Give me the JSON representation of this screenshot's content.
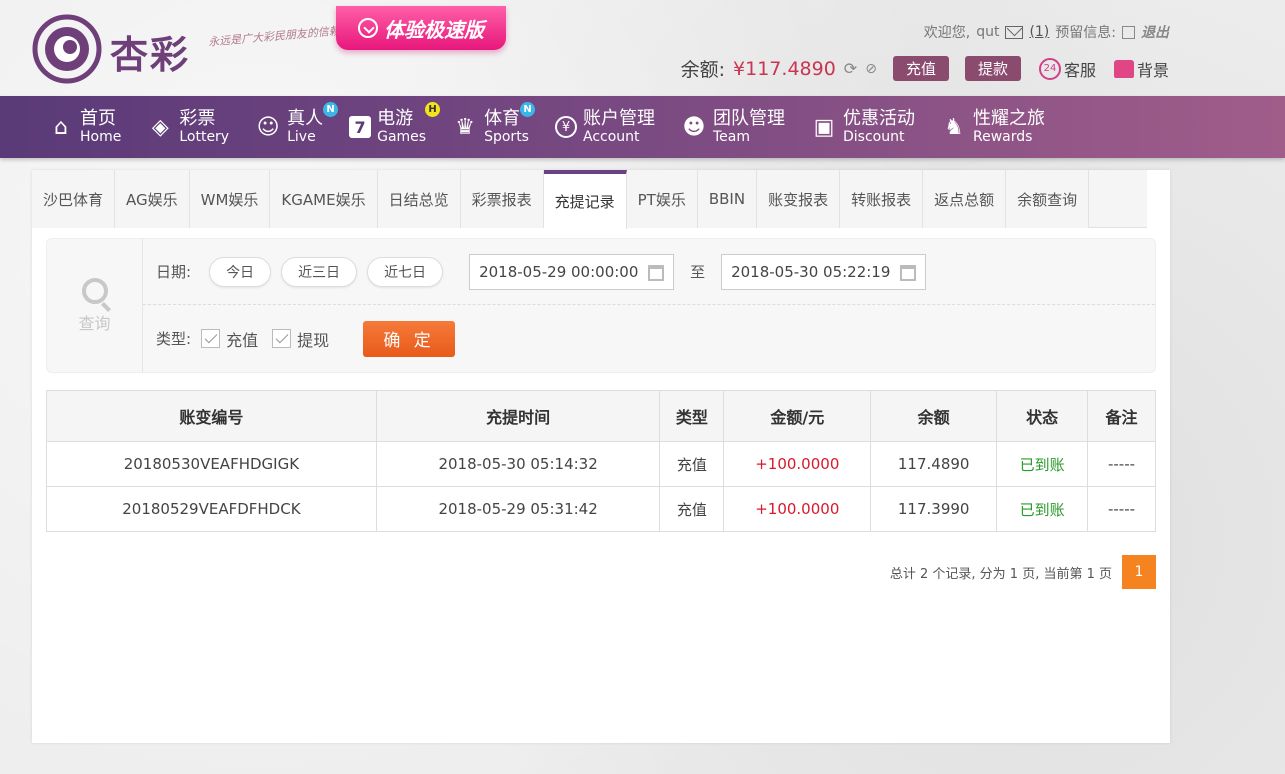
{
  "header": {
    "brand": "杏彩",
    "slogan": "永远是广大彩民朋友的信赖",
    "promo": "体验极速版",
    "welcome": "欢迎您,",
    "username": "qut",
    "messages": "(1)",
    "reserved_info": "预留信息:",
    "logout": "退出",
    "balance_label": "余额:",
    "balance_value": "¥117.4890",
    "deposit": "充值",
    "withdraw": "提款",
    "service": "客服",
    "background": "背景"
  },
  "nav": [
    {
      "cn": "首页",
      "en": "Home",
      "icon": "home-icon",
      "badge": ""
    },
    {
      "cn": "彩票",
      "en": "Lottery",
      "icon": "ticket-icon",
      "badge": ""
    },
    {
      "cn": "真人",
      "en": "Live",
      "icon": "dealer-icon",
      "badge": "N"
    },
    {
      "cn": "电游",
      "en": "Games",
      "icon": "seven-icon",
      "badge": "H"
    },
    {
      "cn": "体育",
      "en": "Sports",
      "icon": "trophy-icon",
      "badge": "N"
    },
    {
      "cn": "账户管理",
      "en": "Account",
      "icon": "yen-icon",
      "badge": ""
    },
    {
      "cn": "团队管理",
      "en": "Team",
      "icon": "team-icon",
      "badge": ""
    },
    {
      "cn": "优惠活动",
      "en": "Discount",
      "icon": "gift-icon",
      "badge": ""
    },
    {
      "cn": "性耀之旅",
      "en": "Rewards",
      "icon": "rewards-icon",
      "badge": ""
    }
  ],
  "tabs": [
    "沙巴体育",
    "AG娱乐",
    "WM娱乐",
    "KGAME娱乐",
    "日结总览",
    "彩票报表",
    "充提记录",
    "PT娱乐",
    "BBIN",
    "账变报表",
    "转账报表",
    "返点总额",
    "余额查询"
  ],
  "active_tab": "充提记录",
  "query": {
    "side_label": "查询",
    "date_label": "日期:",
    "quick": [
      "今日",
      "近三日",
      "近七日"
    ],
    "start": "2018-05-29 00:00:00",
    "to": "至",
    "end": "2018-05-30 05:22:19",
    "type_label": "类型:",
    "types": [
      "充值",
      "提现"
    ],
    "confirm": "确 定"
  },
  "table": {
    "headers": [
      "账变编号",
      "充提时间",
      "类型",
      "金额/元",
      "余额",
      "状态",
      "备注"
    ],
    "rows": [
      [
        "20180530VEAFHDGIGK",
        "2018-05-30 05:14:32",
        "充值",
        "+100.0000",
        "117.4890",
        "已到账",
        "-----"
      ],
      [
        "20180529VEAFDFHDCK",
        "2018-05-29 05:31:42",
        "充值",
        "+100.0000",
        "117.3990",
        "已到账",
        "-----"
      ]
    ]
  },
  "pager": {
    "summary": "总计 2 个记录, 分为 1 页, 当前第 1 页",
    "page": "1"
  },
  "colors": {
    "nav_start": "#5a3a78",
    "nav_end": "#a05d8a",
    "accent_tab": "#6b4185",
    "amount": "#d9182b",
    "status_ok": "#2a9a2a",
    "confirm": "#e85a1a",
    "pager": "#f5831f"
  }
}
